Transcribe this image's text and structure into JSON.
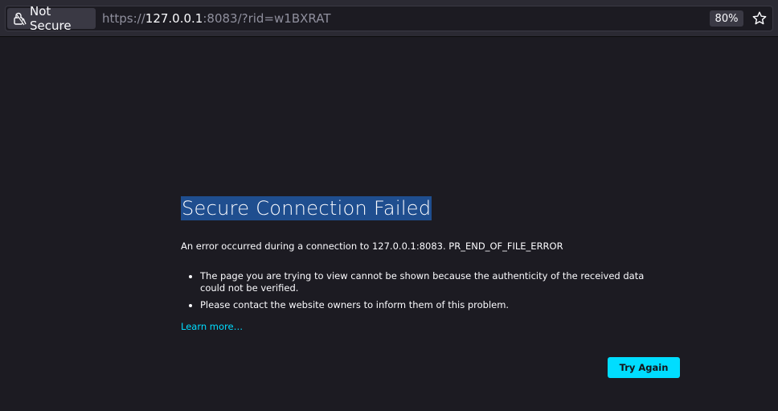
{
  "toolbar": {
    "identity_label": "Not Secure",
    "identity_icon": "lock-warning-icon",
    "url_prefix": "https://",
    "url_host": "127.0.0.1",
    "url_suffix": ":8083/?rid=w1BXRAT",
    "zoom_level": "80%",
    "bookmark_icon": "star-icon"
  },
  "error": {
    "title": "Secure Connection Failed",
    "description": "An error occurred during a connection to 127.0.0.1:8083. PR_END_OF_FILE_ERROR",
    "bullets": [
      "The page you are trying to view cannot be shown because the authenticity of the received data could not be verified.",
      "Please contact the website owners to inform them of this problem."
    ],
    "learn_more": "Learn more…",
    "try_again": "Try Again"
  },
  "colors": {
    "background": "#1c1b22",
    "toolbar": "#2b2a33",
    "accent": "#00ddff",
    "title_highlight": "#1f4e8f"
  }
}
